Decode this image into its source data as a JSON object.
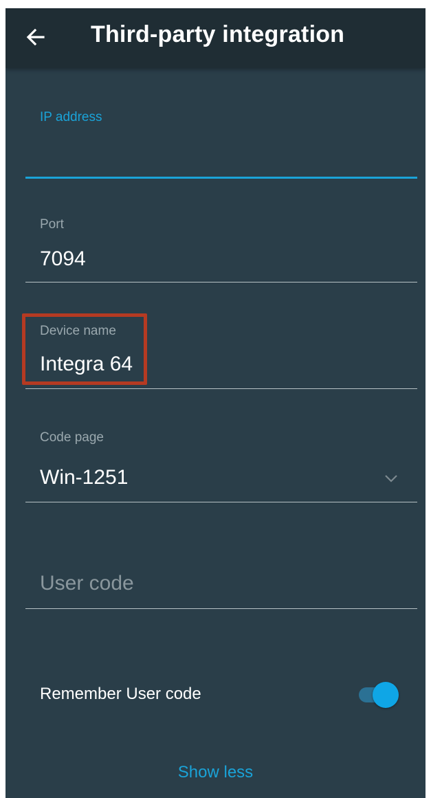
{
  "header": {
    "title": "Third-party integration",
    "back_icon": "arrow-left-icon"
  },
  "fields": {
    "ip_address": {
      "label": "IP address",
      "value": ""
    },
    "port": {
      "label": "Port",
      "value": "7094"
    },
    "device_name": {
      "label": "Device name",
      "value": "Integra 64"
    },
    "code_page": {
      "label": "Code page",
      "value": "Win-1251",
      "icon": "chevron-down-icon"
    },
    "user_code": {
      "placeholder": "User code",
      "value": ""
    }
  },
  "remember": {
    "label": "Remember User code",
    "enabled": true
  },
  "footer": {
    "show_less": "Show less"
  },
  "colors": {
    "background": "#2a3e49",
    "appbar": "#1f2d34",
    "accent": "#1aa3d8",
    "highlight": "#b53a22"
  }
}
